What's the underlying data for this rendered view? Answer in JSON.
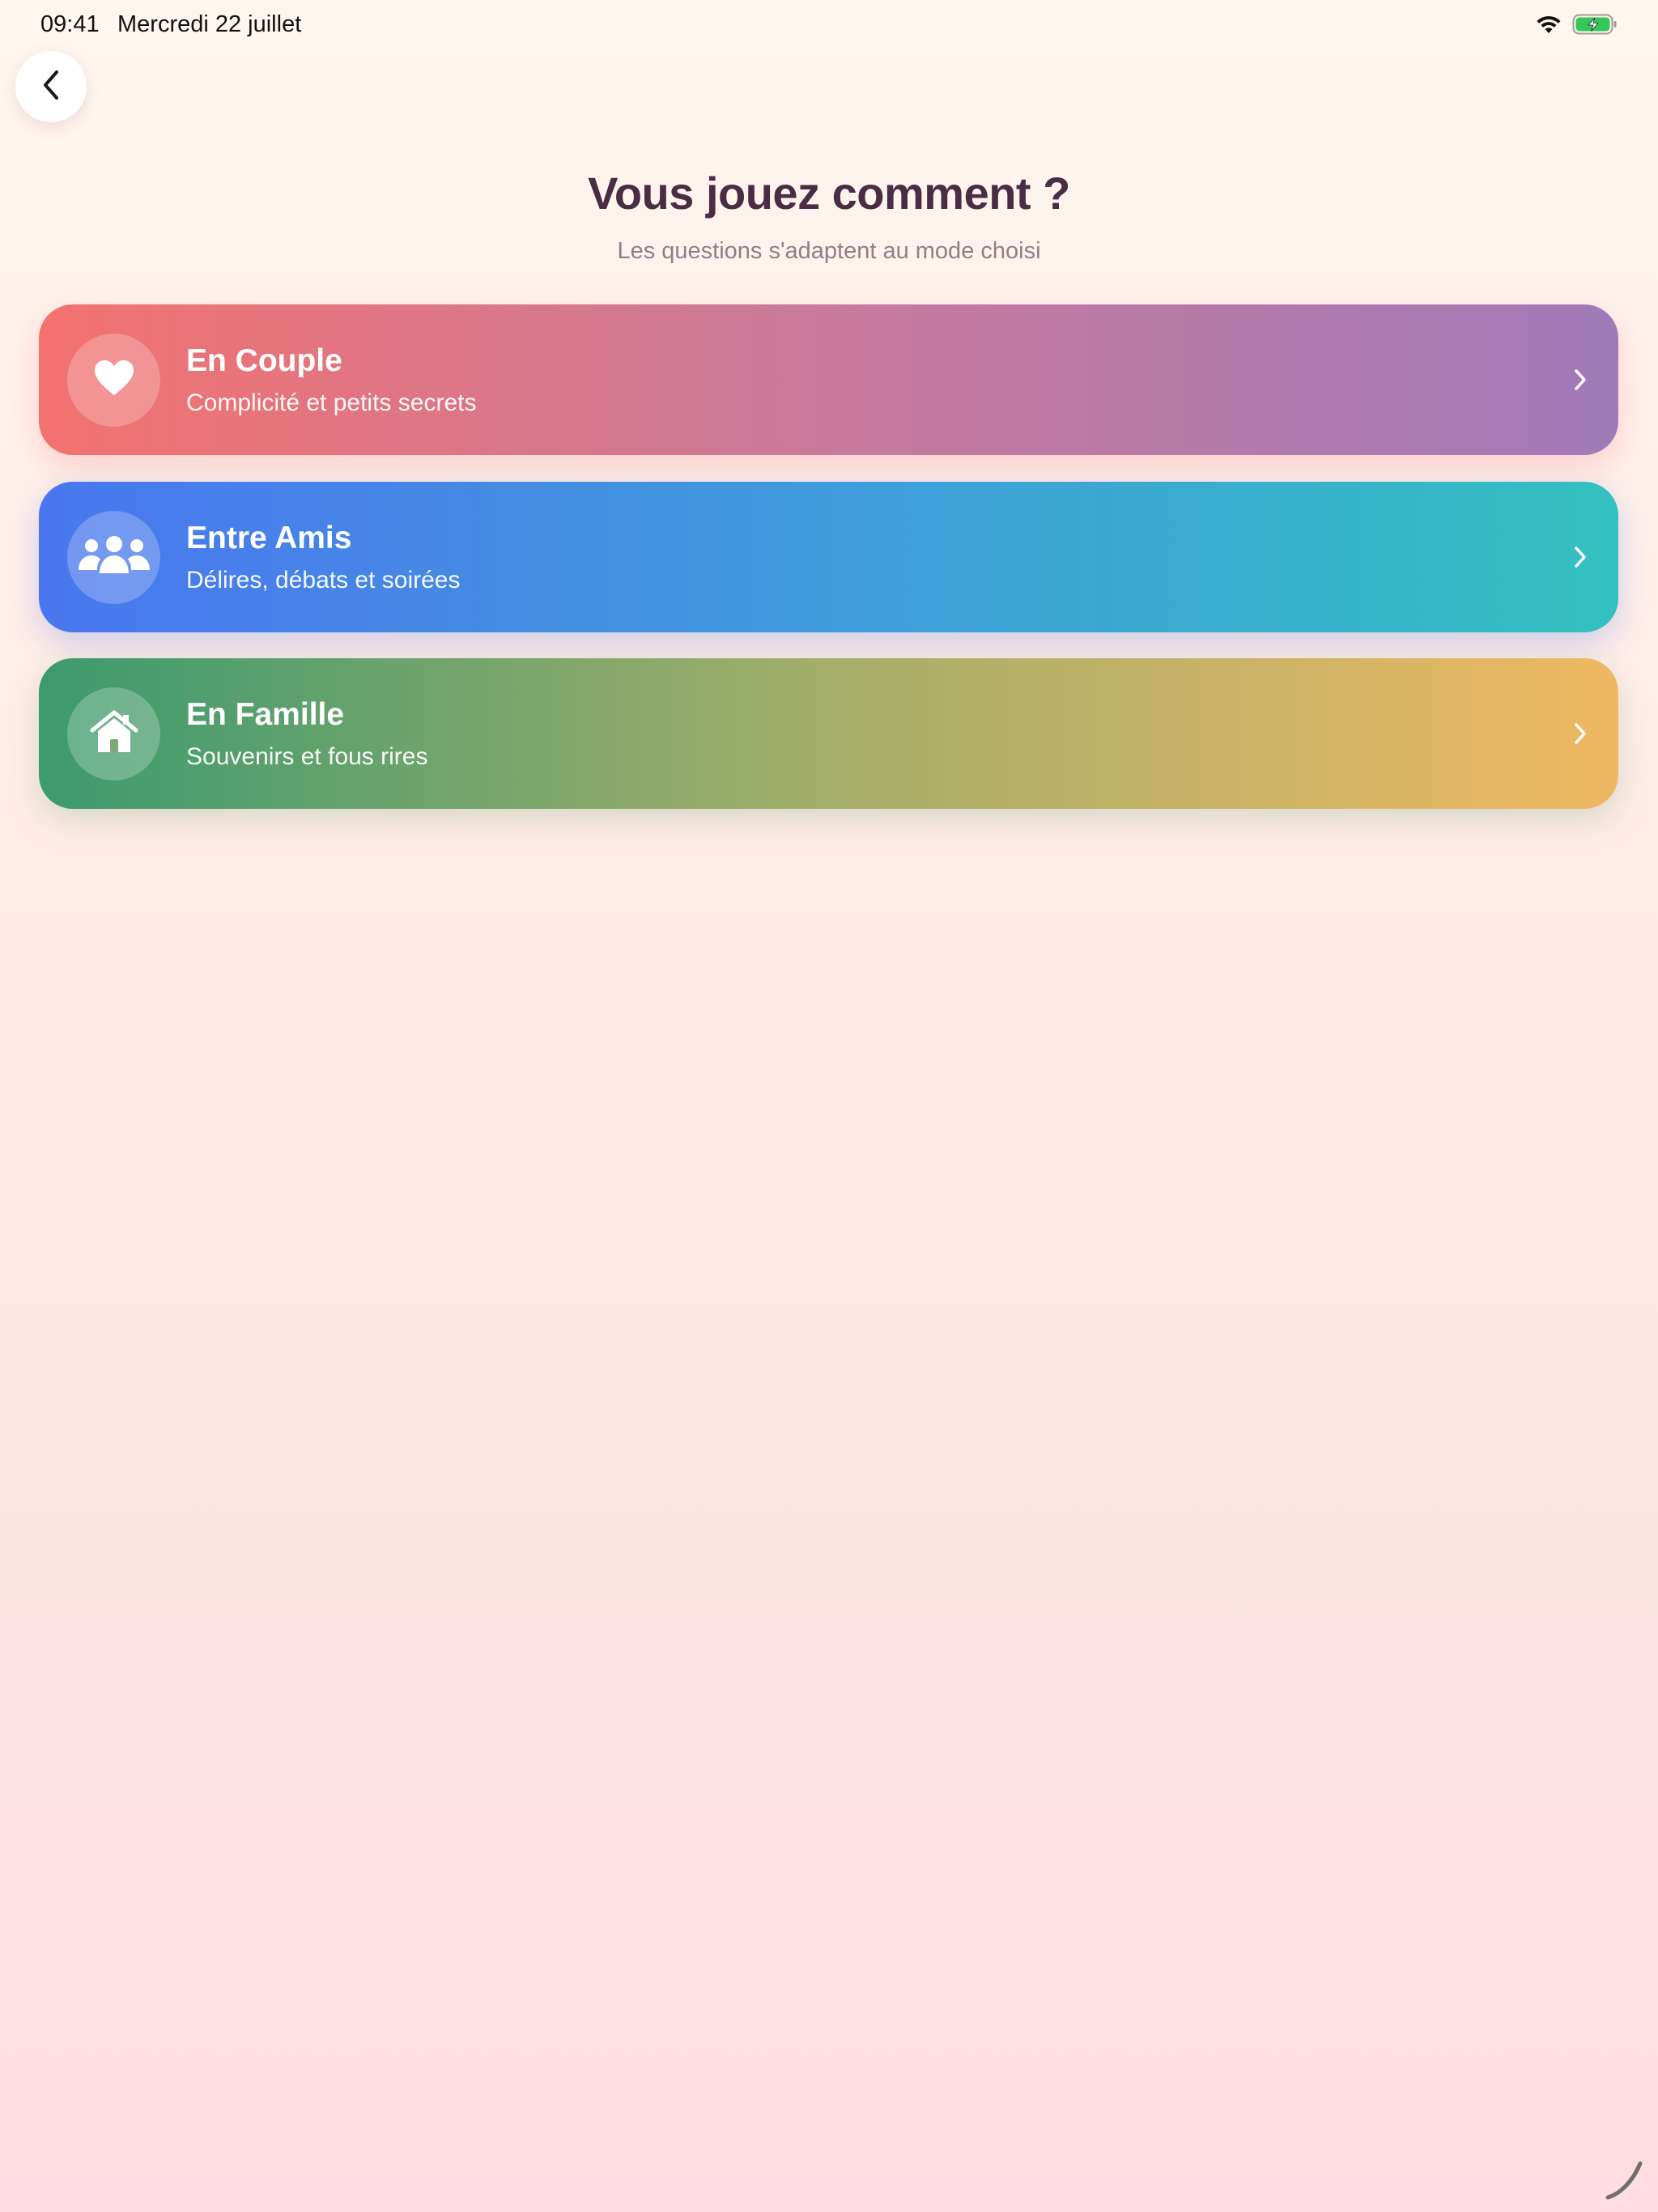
{
  "status_bar": {
    "time": "09:41",
    "date": "Mercredi 22 juillet",
    "wifi_icon": "wifi-icon",
    "battery_icon": "battery-charging-icon",
    "battery_color": "#34c759"
  },
  "navigation": {
    "back_icon": "chevron-left-icon"
  },
  "header": {
    "title": "Vous jouez comment ?",
    "subtitle": "Les questions s'adaptent au mode choisi"
  },
  "modes": [
    {
      "id": "couple",
      "title": "En Couple",
      "subtitle": "Complicité et petits secrets",
      "icon": "heart-icon",
      "gradient": [
        "#f2726f",
        "#a07ab9"
      ]
    },
    {
      "id": "amis",
      "title": "Entre Amis",
      "subtitle": "Délires, débats et soirées",
      "icon": "group-icon",
      "gradient": [
        "#4a76ef",
        "#33c1c0"
      ]
    },
    {
      "id": "famille",
      "title": "En Famille",
      "subtitle": "Souvenirs et fous rires",
      "icon": "house-icon",
      "gradient": [
        "#3c9a6e",
        "#efb862"
      ]
    }
  ],
  "colors": {
    "title": "#4a2c45",
    "subtitle": "#8f7f8a",
    "background_top": "#fff6ef",
    "background_bottom": "#ffdde2"
  }
}
